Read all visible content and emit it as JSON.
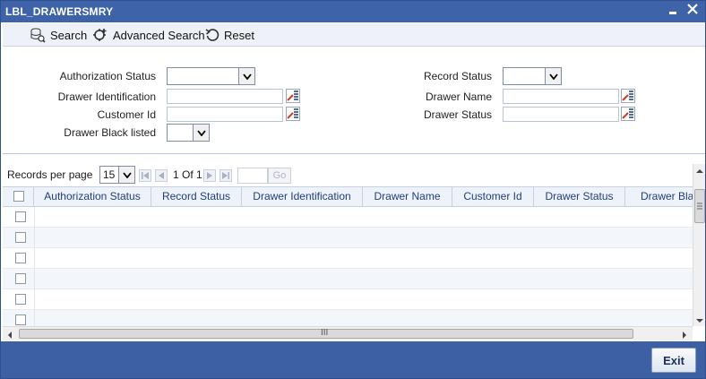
{
  "window": {
    "title": "LBL_DRAWERSMRY",
    "minimize_glyph": "▁",
    "close_glyph": "✕"
  },
  "toolbar": {
    "search_label": "Search",
    "advanced_search_label": "Advanced Search",
    "reset_label": "Reset",
    "icons": [
      "database-search-icon",
      "advanced-search-icon",
      "reset-icon"
    ]
  },
  "criteria": {
    "authorization_status_label": "Authorization Status",
    "authorization_status_value": "",
    "record_status_label": "Record Status",
    "record_status_value": "",
    "drawer_identification_label": "Drawer Identification",
    "drawer_identification_value": "",
    "drawer_name_label": "Drawer Name",
    "drawer_name_value": "",
    "customer_id_label": "Customer Id",
    "customer_id_value": "",
    "drawer_status_label": "Drawer Status",
    "drawer_status_value": "",
    "drawer_black_listed_label": "Drawer Black listed",
    "drawer_black_listed_value": ""
  },
  "pager": {
    "records_per_page_label": "Records per page",
    "records_per_page_value": "15",
    "page_info": "1 Of 1",
    "goto_value": "",
    "go_label": "Go"
  },
  "grid": {
    "columns": [
      "Authorization Status",
      "Record Status",
      "Drawer Identification",
      "Drawer Name",
      "Customer Id",
      "Drawer Status",
      "Drawer Bla"
    ],
    "row_count": 6
  },
  "scrollbar": {
    "grip_glyph": "III",
    "v_grip_glyph": "≡"
  },
  "footer": {
    "exit_label": "Exit"
  },
  "colors": {
    "titlebar": "#3f63a9",
    "footer": "#3d5fa3",
    "header_text": "#1f3f7f",
    "lov_accent": "#d23a1e"
  }
}
